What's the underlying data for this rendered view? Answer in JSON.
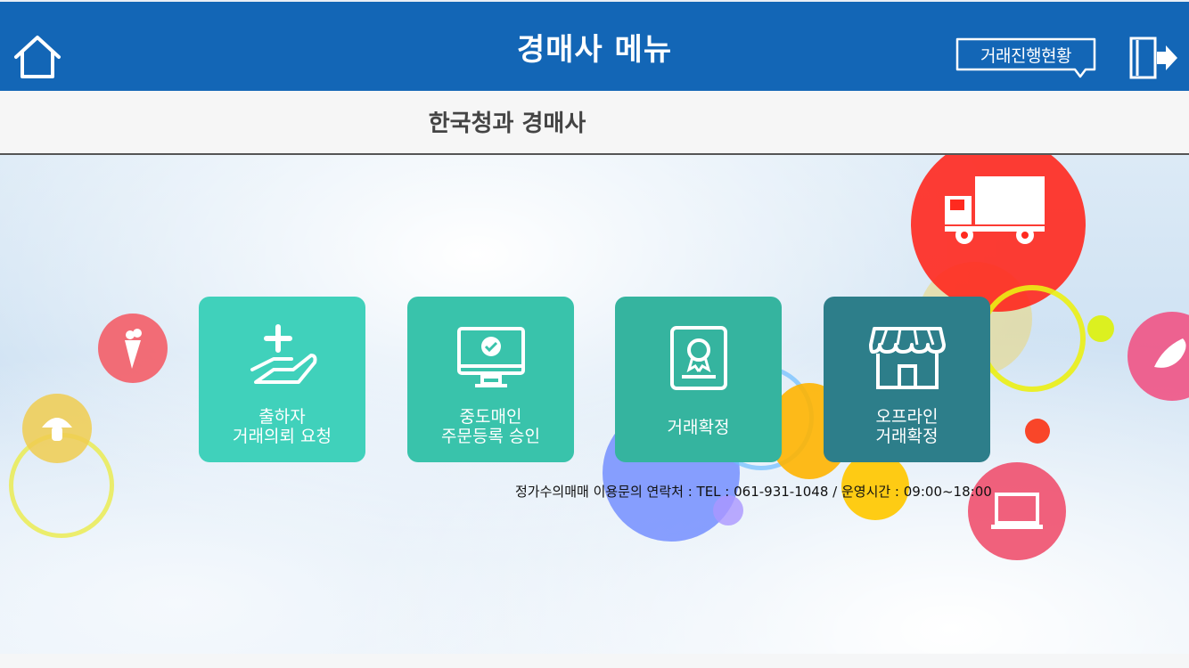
{
  "header": {
    "title": "경매사 메뉴",
    "status_button_label": "거래진행현황",
    "home_icon": "home-icon",
    "exit_icon": "exit-icon"
  },
  "subheader": {
    "title": "한국청과 경매사"
  },
  "menu": [
    {
      "line1": "출하자",
      "line2": "거래의뢰 요청",
      "icon": "hand-plus-icon",
      "color": "#40d1bb"
    },
    {
      "line1": "중도매인",
      "line2": "주문등록 승인",
      "icon": "monitor-check-icon",
      "color": "#39c3ab"
    },
    {
      "line1": "거래확정",
      "line2": "",
      "icon": "certificate-icon",
      "color": "#35b49f"
    },
    {
      "line1": "오프라인",
      "line2": "거래확정",
      "icon": "store-icon",
      "color": "#2d7e8a"
    }
  ],
  "contact_info": "정가수의매매 이용문의 연락처 : TEL : 061-931-1048 / 운영시간 : 09:00~18:00",
  "colors": {
    "header_bg": "#1366b6",
    "subheader_bg": "#f6f6f6"
  }
}
